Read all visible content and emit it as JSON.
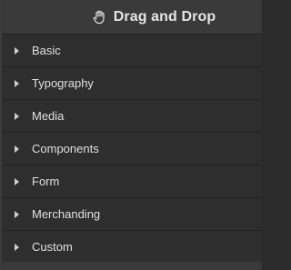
{
  "header": {
    "title": "Drag and Drop",
    "icon": "hand-icon"
  },
  "categories": [
    {
      "label": "Basic"
    },
    {
      "label": "Typography"
    },
    {
      "label": "Media"
    },
    {
      "label": "Components"
    },
    {
      "label": "Form"
    },
    {
      "label": "Merchanding"
    },
    {
      "label": "Custom"
    }
  ],
  "colors": {
    "background": "#2e2e2e",
    "header": "#3a3a3a",
    "text": "#e0e0e0"
  }
}
